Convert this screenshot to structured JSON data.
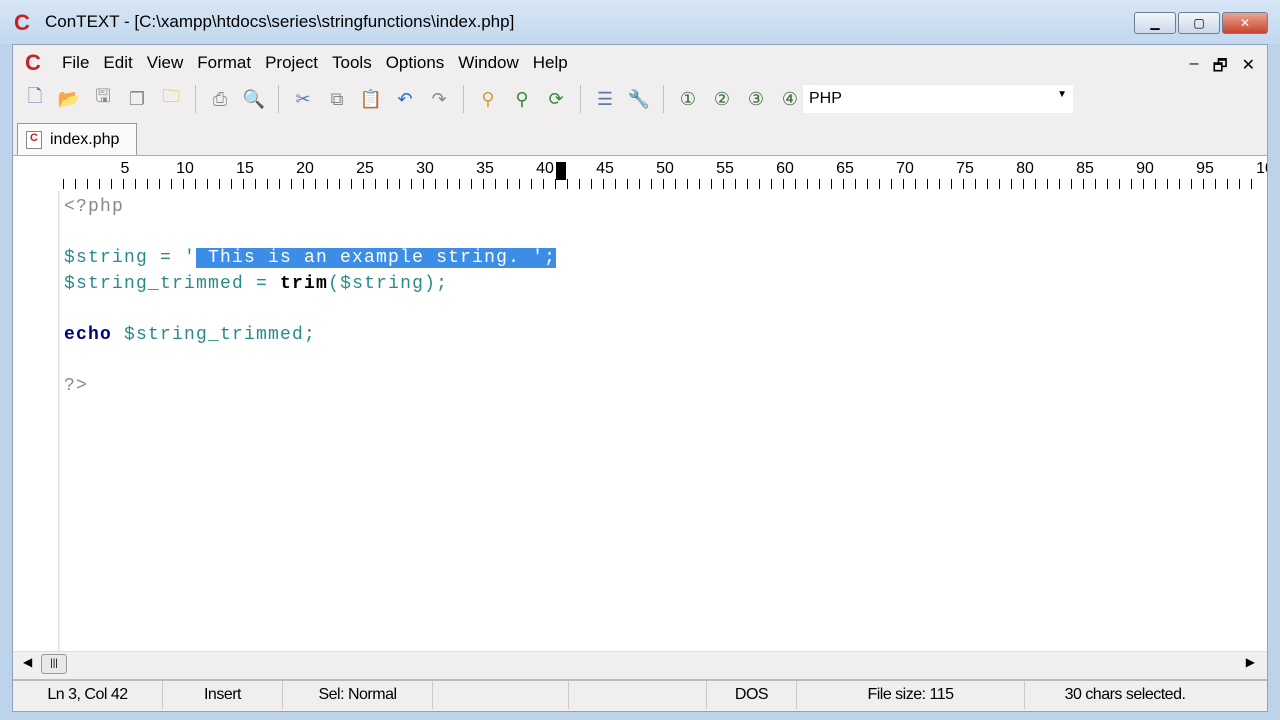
{
  "window": {
    "title": "ConTEXT - [C:\\xampp\\htdocs\\series\\stringfunctions\\index.php]",
    "logo": "C",
    "minimize": "▁",
    "maximize": "▢",
    "close": "✕"
  },
  "menu": {
    "items": [
      "File",
      "Edit",
      "View",
      "Format",
      "Project",
      "Tools",
      "Options",
      "Window",
      "Help"
    ],
    "mdi": [
      "‒",
      "🗗",
      "✕"
    ]
  },
  "toolbar": {
    "icons": [
      "new-file-icon",
      "open-icon",
      "save-icon",
      "save-all-icon",
      "open-folder-icon",
      "print-icon",
      "print-preview-icon",
      "cut-icon",
      "copy-icon",
      "paste-icon",
      "undo-icon",
      "redo-icon",
      "find-icon",
      "find-next-icon",
      "replace-icon",
      "document-icon",
      "settings-icon",
      "user1-icon",
      "user2-icon",
      "user3-icon",
      "user4-icon"
    ],
    "highlighter": "PHP"
  },
  "tab": {
    "label": "index.php"
  },
  "ruler": {
    "labels": [
      "5",
      "10",
      "15",
      "20",
      "25",
      "30",
      "35",
      "40",
      "45",
      "50",
      "55",
      "60",
      "65",
      "70",
      "75",
      "80",
      "85",
      "90",
      "95",
      "10"
    ],
    "cursor_col": 42
  },
  "code": {
    "l1": "<?php",
    "l3a": "$string = '",
    "l3sel": " This is an example string. ';",
    "l4a": "$string_trimmed = ",
    "l4fn": "trim",
    "l4b": "($string);",
    "l6kw": "echo",
    "l6b": " $string_trimmed;",
    "l8": "?>"
  },
  "status": {
    "position": "Ln 3, Col 42",
    "mode": "Insert",
    "sel_mode": "Sel: Normal",
    "empty1": "",
    "empty2": "",
    "format": "DOS",
    "file_size": "File size: 115",
    "selection": "30 chars selected."
  }
}
